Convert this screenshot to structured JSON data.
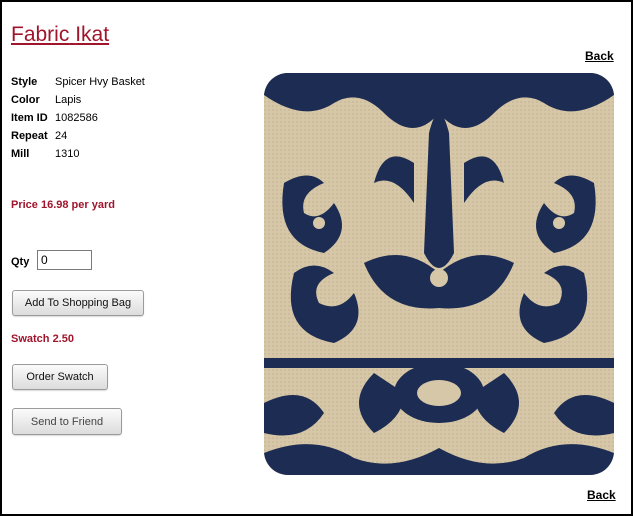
{
  "product": {
    "title_word1": "Fabric",
    "title_word2": "Ikat",
    "back_top": "Back",
    "back_bottom": "Back"
  },
  "specs": [
    {
      "label": "Style",
      "value": "Spicer Hvy Basket"
    },
    {
      "label": "Color",
      "value": "Lapis"
    },
    {
      "label": "Item ID",
      "value": "1082586"
    },
    {
      "label": "Repeat",
      "value": "24"
    },
    {
      "label": "Mill",
      "value": "1310"
    }
  ],
  "price_text": "Price 16.98 per yard",
  "qty": {
    "label": "Qty",
    "value": "0"
  },
  "buttons": {
    "add_to_bag": "Add To Shopping Bag",
    "order_swatch": "Order Swatch",
    "send_to_friend": "Send to Friend"
  },
  "swatch_text": "Swatch 2.50",
  "colors": {
    "accent": "#a0142c",
    "fabric_navy": "#1d2c52",
    "fabric_linen": "#d6c7a8"
  }
}
